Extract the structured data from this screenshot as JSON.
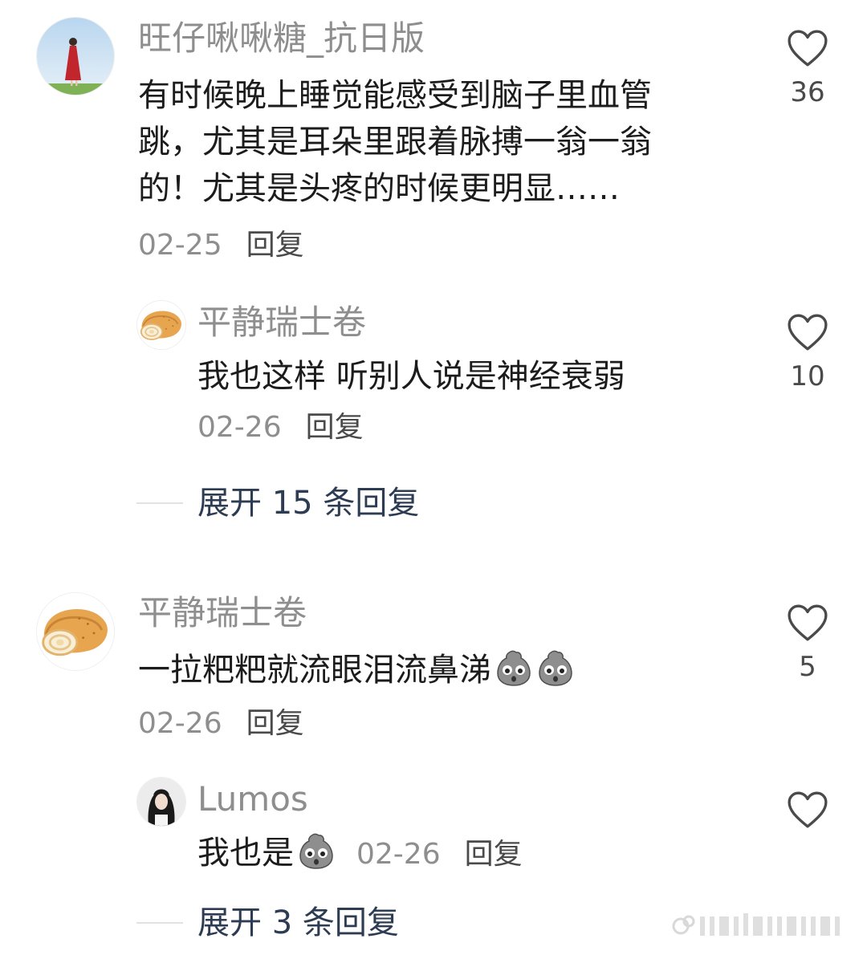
{
  "comments": [
    {
      "user": "旺仔啾啾糖_抗日版",
      "lines": [
        "有时候晚上睡觉能感受到脑子里血管",
        "跳，尤其是耳朵里跟着脉搏一翁一翁",
        "的！尤其是头疼的时候更明显……"
      ],
      "date": "02-25",
      "reply_label": "回复",
      "likes": "36",
      "avatar_icon": "girl-in-red-dress-avatar",
      "reply": {
        "user": "平静瑞士卷",
        "text": "我也这样 听别人说是神经衰弱",
        "date": "02-26",
        "reply_label": "回复",
        "likes": "10",
        "avatar_icon": "swiss-roll-avatar"
      },
      "expand_label": "展开 15 条回复"
    },
    {
      "user": "平静瑞士卷",
      "text": "一拉粑粑就流眼泪流鼻涕",
      "emoji": [
        "shocked-potato-emoji",
        "shocked-potato-emoji"
      ],
      "date": "02-26",
      "reply_label": "回复",
      "likes": "5",
      "avatar_icon": "swiss-roll-avatar",
      "reply": {
        "user": "Lumos",
        "text": "我也是",
        "emoji": [
          "shocked-potato-emoji"
        ],
        "date": "02-26",
        "reply_label": "回复",
        "likes": "",
        "avatar_icon": "dark-hair-girl-avatar"
      },
      "expand_label": "展开 3 条回复"
    }
  ],
  "colors": {
    "text": "#1c1c1c",
    "muted": "#8e8e8e",
    "expand": "#2d3c52",
    "divider": "#e2e2e2"
  },
  "icons": {
    "like": "heart-outline-icon"
  }
}
